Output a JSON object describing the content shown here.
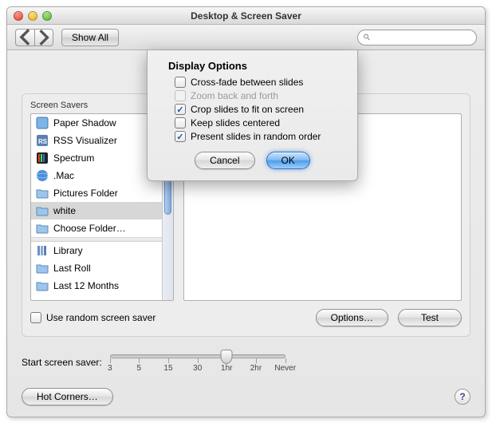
{
  "window": {
    "title": "Desktop & Screen Saver"
  },
  "toolbar": {
    "show_all": "Show All",
    "search_placeholder": ""
  },
  "sheet": {
    "title": "Display Options",
    "options": [
      {
        "label": "Cross-fade between slides",
        "checked": false,
        "enabled": true
      },
      {
        "label": "Zoom back and forth",
        "checked": false,
        "enabled": false
      },
      {
        "label": "Crop slides to fit on screen",
        "checked": true,
        "enabled": true
      },
      {
        "label": "Keep slides centered",
        "checked": false,
        "enabled": true
      },
      {
        "label": "Present slides in random order",
        "checked": true,
        "enabled": true
      }
    ],
    "cancel": "Cancel",
    "ok": "OK"
  },
  "savers": {
    "label": "Screen Savers",
    "items": [
      {
        "label": "Paper Shadow",
        "icon": "paper"
      },
      {
        "label": "RSS Visualizer",
        "icon": "rss"
      },
      {
        "label": "Spectrum",
        "icon": "spectrum"
      },
      {
        "label": ".Mac",
        "icon": "mac"
      },
      {
        "label": "Pictures Folder",
        "icon": "folder"
      },
      {
        "label": "white",
        "icon": "folder",
        "selected": true
      },
      {
        "label": "Choose Folder…",
        "icon": "folder"
      }
    ],
    "extra": [
      {
        "label": "Library",
        "icon": "library"
      },
      {
        "label": "Last Roll",
        "icon": "folder"
      },
      {
        "label": "Last 12 Months",
        "icon": "folder"
      }
    ]
  },
  "random_checkbox": "Use random screen saver",
  "options_btn": "Options…",
  "test_btn": "Test",
  "slider": {
    "label": "Start screen saver:",
    "ticks": [
      "3",
      "5",
      "15",
      "30",
      "1hr",
      "2hr",
      "Never"
    ]
  },
  "hot_corners": "Hot Corners…",
  "help": "?"
}
